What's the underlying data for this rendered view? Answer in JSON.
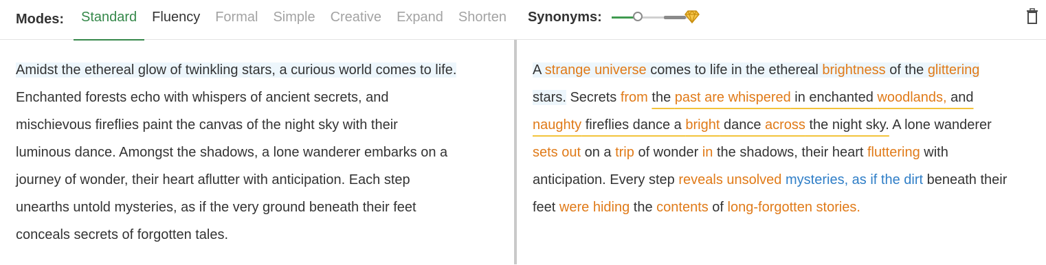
{
  "toolbar": {
    "modes_label": "Modes:",
    "modes": [
      {
        "label": "Standard",
        "state": "active"
      },
      {
        "label": "Fluency",
        "state": "enabled"
      },
      {
        "label": "Formal",
        "state": "disabled"
      },
      {
        "label": "Simple",
        "state": "disabled"
      },
      {
        "label": "Creative",
        "state": "disabled"
      },
      {
        "label": "Expand",
        "state": "disabled"
      },
      {
        "label": "Shorten",
        "state": "disabled"
      }
    ],
    "synonyms_label": "Synonyms:",
    "synonyms_level": 0.4,
    "accent_color": "#35884a",
    "premium_icon": "diamond-icon",
    "delete_icon": "trash-icon"
  },
  "input_text": {
    "lines": [
      "Amidst the ethereal glow of twinkling stars, a curious world comes to life.",
      "Enchanted forests echo with whispers of ancient secrets, and",
      "mischievous fireflies paint the canvas of the night sky with their",
      "luminous dance. Amongst the shadows, a lone wanderer embarks on a",
      "journey of wonder, their heart aflutter with anticipation. Each step",
      "unearths untold mysteries, as if the very ground beneath their feet",
      "conceals secrets of forgotten tales."
    ]
  },
  "output_text": {
    "lines": [
      [
        {
          "t": "A ",
          "s": "plain"
        },
        {
          "t": "strange universe",
          "s": "changed"
        },
        {
          "t": " comes to life in the ethereal ",
          "s": "plain"
        },
        {
          "t": "brightness",
          "s": "changed"
        },
        {
          "t": " of the ",
          "s": "plain"
        },
        {
          "t": "glittering",
          "s": "changed"
        }
      ],
      [
        {
          "t": "stars.",
          "s": "plain"
        },
        {
          "t": " Secrets ",
          "s": "plain"
        },
        {
          "t": "from",
          "s": "changed"
        },
        {
          "t": " ",
          "s": "plain"
        },
        {
          "t": "the ",
          "s": "plain-u"
        },
        {
          "t": "past are whispered",
          "s": "changed-u"
        },
        {
          "t": " in enchanted ",
          "s": "plain-u"
        },
        {
          "t": "woodlands,",
          "s": "changed-u"
        },
        {
          "t": " and",
          "s": "plain-u"
        }
      ],
      [
        {
          "t": "naughty",
          "s": "changed-u"
        },
        {
          "t": " fireflies dance a ",
          "s": "plain-u"
        },
        {
          "t": "bright",
          "s": "changed-u"
        },
        {
          "t": " dance ",
          "s": "plain-u"
        },
        {
          "t": "across",
          "s": "changed-u"
        },
        {
          "t": " the night sky.",
          "s": "plain-u"
        },
        {
          "t": " A lone wanderer",
          "s": "plain"
        }
      ],
      [
        {
          "t": "sets out",
          "s": "changed"
        },
        {
          "t": " on a ",
          "s": "plain"
        },
        {
          "t": "trip",
          "s": "changed"
        },
        {
          "t": " of wonder ",
          "s": "plain"
        },
        {
          "t": "in",
          "s": "changed"
        },
        {
          "t": " the shadows, their heart ",
          "s": "plain"
        },
        {
          "t": "fluttering",
          "s": "changed"
        },
        {
          "t": " with",
          "s": "plain"
        }
      ],
      [
        {
          "t": "anticipation. Every step ",
          "s": "plain"
        },
        {
          "t": "reveals unsolved",
          "s": "changed"
        },
        {
          "t": " ",
          "s": "plain"
        },
        {
          "t": "mysteries, as if the dirt",
          "s": "structural"
        },
        {
          "t": " beneath their",
          "s": "plain"
        }
      ],
      [
        {
          "t": "feet ",
          "s": "plain"
        },
        {
          "t": "were hiding",
          "s": "changed"
        },
        {
          "t": " the ",
          "s": "plain"
        },
        {
          "t": "contents",
          "s": "changed"
        },
        {
          "t": " of ",
          "s": "plain"
        },
        {
          "t": "long-forgotten stories.",
          "s": "changed"
        }
      ]
    ],
    "changed_color": "#e07a18",
    "structural_color": "#2f7ec7",
    "underline_color": "#f3c33a",
    "sentence_highlight_color": "#edf6fc"
  }
}
